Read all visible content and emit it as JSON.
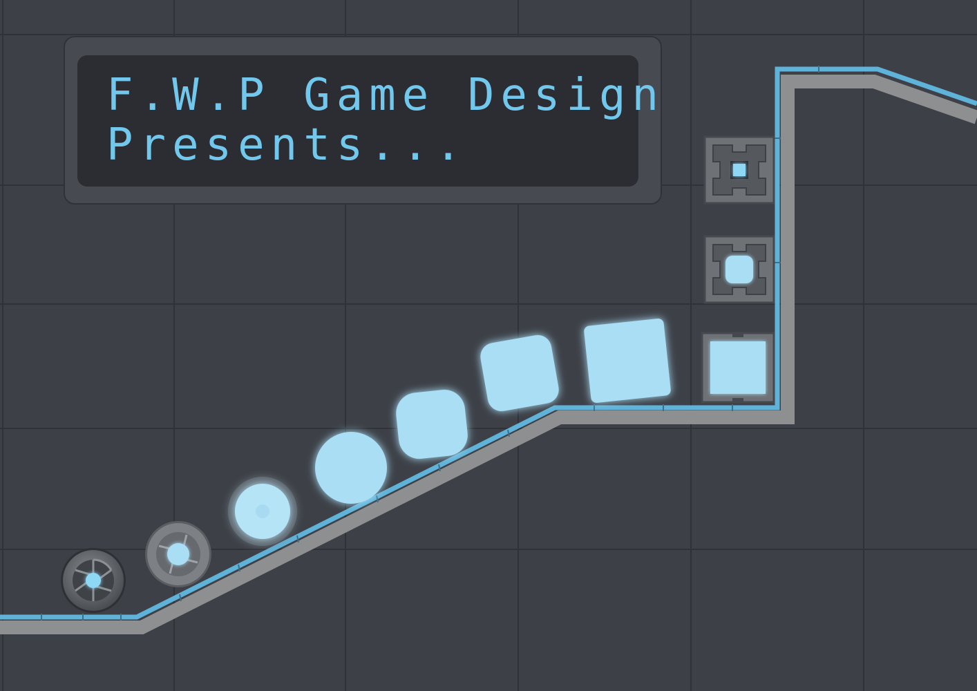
{
  "title": {
    "line1": "F.W.P Game Design",
    "line2": "Presents..."
  },
  "colors": {
    "background": "#3d4047",
    "tile_lines": "#2f3237",
    "panel": "#2b2d32",
    "panel_frame": "#474a50",
    "text": "#72c8ec",
    "glow": "#a9def5",
    "track": "#8e8f91",
    "track_glow": "#5fb2d8"
  },
  "icons": [
    "aperture-ball-icon",
    "glowing-orb-icon",
    "glowing-cube-icon",
    "emitter-block-icon"
  ]
}
